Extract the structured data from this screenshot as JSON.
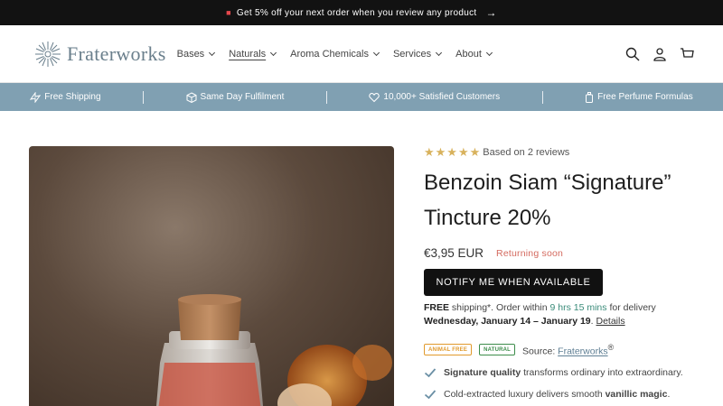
{
  "announcement": {
    "icon": "gift-icon",
    "text": "Get 5% off your next order when you review any product",
    "arrow": "→"
  },
  "header": {
    "logo_text": "Fraterworks",
    "nav": [
      {
        "label": "Bases",
        "active": false
      },
      {
        "label": "Naturals",
        "active": true
      },
      {
        "label": "Aroma Chemicals",
        "active": false
      },
      {
        "label": "Services",
        "active": false
      },
      {
        "label": "About",
        "active": false
      }
    ],
    "icons": [
      "search-icon",
      "account-icon",
      "cart-icon"
    ]
  },
  "usp": [
    {
      "icon": "truck-icon",
      "label": "Free Shipping"
    },
    {
      "icon": "box-icon",
      "label": "Same Day Fulfilment"
    },
    {
      "icon": "heart-icon",
      "label": "10,000+ Satisfied Customers"
    },
    {
      "icon": "bottle-icon",
      "label": "Free Perfume Formulas"
    }
  ],
  "product": {
    "rating_stars": 5,
    "reviews_text": "Based on 2 reviews",
    "title_line1": "Benzoin Siam “Signature”",
    "title_line2": "Tincture 20%",
    "price": "€3,95 EUR",
    "availability": "Returning soon",
    "notify_button": "NOTIFY ME WHEN AVAILABLE",
    "shipping": {
      "free": "FREE",
      "text1": " shipping*. Order within ",
      "time": "9 hrs 15 mins",
      "text2": " for delivery",
      "dates": "Wednesday, January 14 – January 19",
      "dot": ".",
      "details_link": "Details"
    },
    "badges": {
      "animal_free": "ANIMAL FREE",
      "natural": "NATURAL"
    },
    "source_label": "Source:",
    "source_link": "Fraterworks",
    "source_mark": "®",
    "features": [
      {
        "bold": "Signature quality",
        "rest": " transforms ordinary into extraordinary."
      },
      {
        "pre": "Cold-extracted luxury delivers smooth ",
        "bold": "vanillic magic",
        "post": "."
      }
    ]
  },
  "colors": {
    "accent_blue": "#80a0b2",
    "returning_soon": "#d46a5f",
    "star": "#d8b25d",
    "timer": "#3b8c7a"
  }
}
